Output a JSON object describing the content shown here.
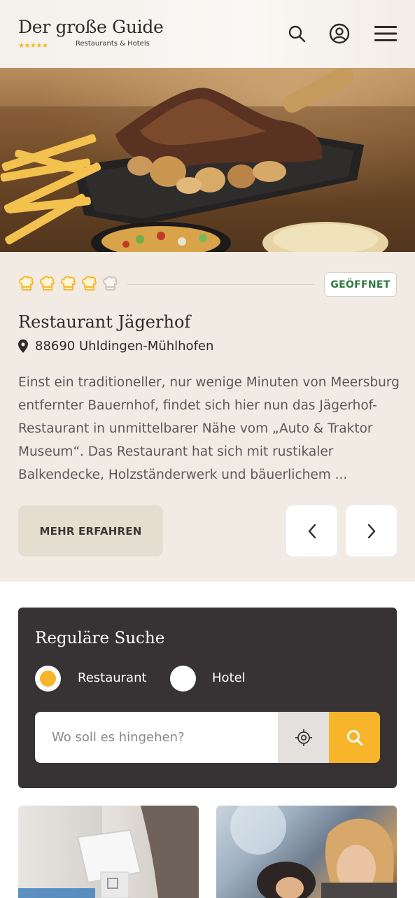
{
  "header": {
    "title": "Der große Guide",
    "stars": "★★★★★",
    "subtitle": "Restaurants & Hotels",
    "icons": [
      "search-icon",
      "user-icon",
      "menu-icon"
    ]
  },
  "listing": {
    "rating": 4,
    "rating_max": 5,
    "status": "GEÖFFNET",
    "name": "Restaurant Jägerhof",
    "location": "88690 Uhldingen-Mühlhofen",
    "description_lines": [
      "Einst ein traditioneller, nur wenige Minuten von Meersburg",
      "entfernter Bauernhof, findet sich hier nun das Jägerhof-",
      "Restaurant in unmittelbarer Nähe vom „Auto & Traktor",
      "Museum“. Das Restaurant hat sich mit rustikaler",
      "Balkendecke, Holzständerwerk und bäuerlichem ..."
    ],
    "more_label": "MEHR ERFAHREN"
  },
  "search": {
    "title": "Reguläre Suche",
    "option_restaurant": "Restaurant",
    "option_hotel": "Hotel",
    "selected": "Restaurant",
    "placeholder": "Wo soll es hingehen?",
    "value": ""
  },
  "colors": {
    "accent": "#f6b52a",
    "status_green": "#2b7a3b",
    "panel_dark": "#373233",
    "card_bg": "#f2ebe4"
  }
}
